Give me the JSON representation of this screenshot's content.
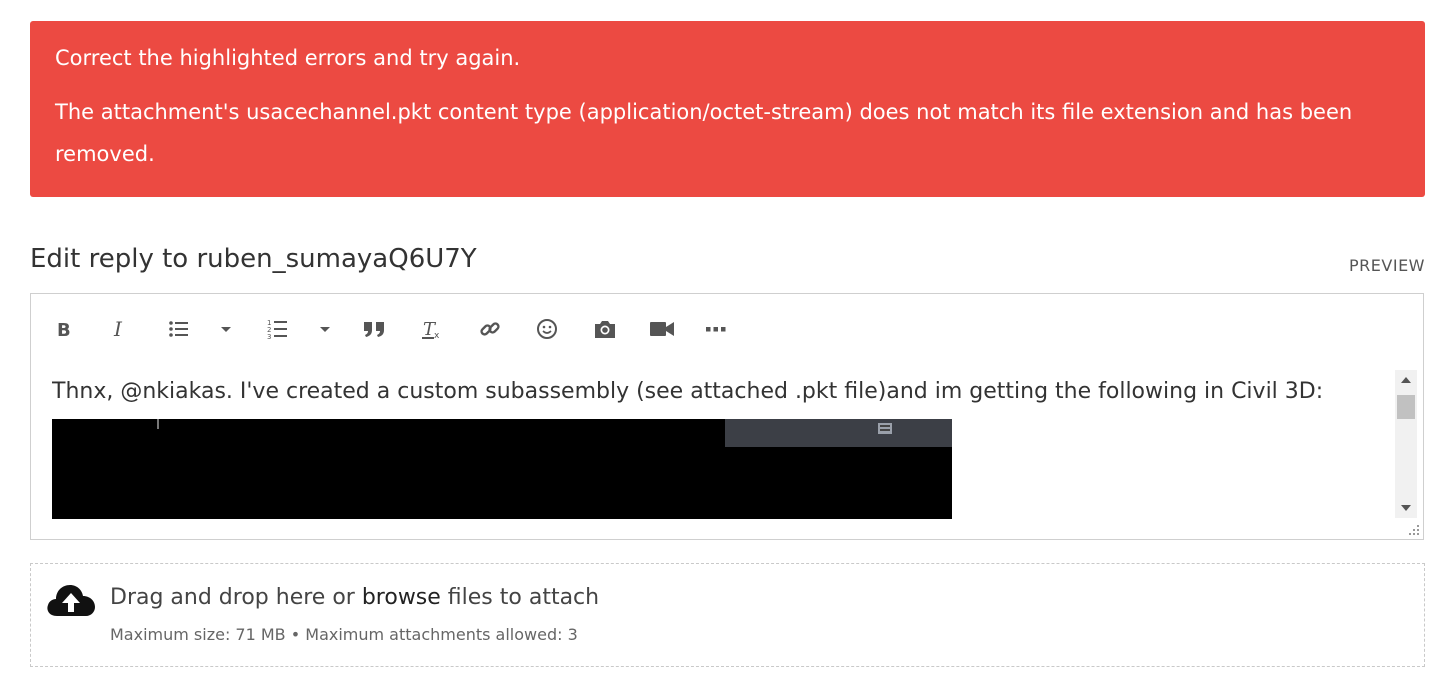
{
  "error": {
    "line1": "Correct the highlighted errors and try again.",
    "line2": "The attachment's usacechannel.pkt content type (application/octet-stream) does not match its file extension and has been removed."
  },
  "editor": {
    "title": "Edit reply to ruben_sumayaQ6U7Y",
    "preview_label": "PREVIEW",
    "toolbar": [
      "bold-icon",
      "italic-icon",
      "bulleted-list-icon",
      "chevron-down-icon",
      "numbered-list-icon",
      "chevron-down-icon",
      "quote-icon",
      "clear-format-icon",
      "link-icon",
      "emoji-icon",
      "camera-icon",
      "video-icon",
      "more-icon"
    ],
    "content_text": "Thnx, @nkiakas.  I've created a custom subassembly (see attached .pkt file)and im getting the following in Civil 3D:"
  },
  "dropzone": {
    "prefix": "Drag and drop here or ",
    "browse": "browse",
    "suffix": " files to attach",
    "limits": "Maximum size: 71 MB • Maximum attachments allowed: 3",
    "icon": "cloud-upload-icon"
  },
  "colors": {
    "error_bg": "#ec4a42"
  }
}
